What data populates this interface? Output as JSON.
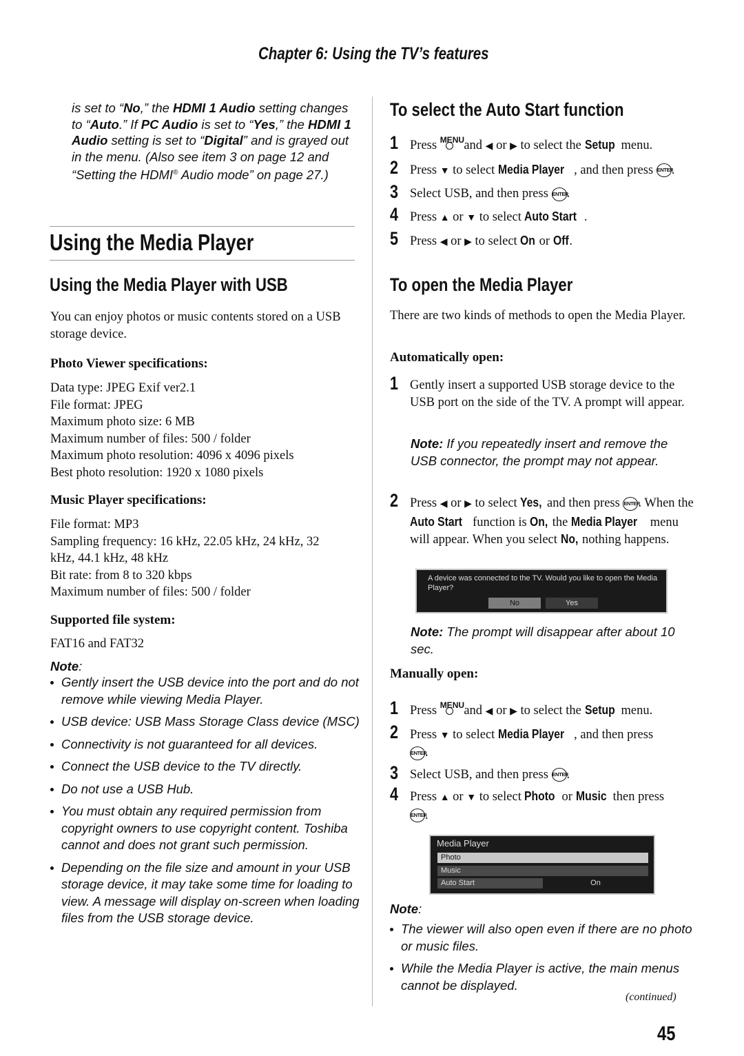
{
  "header": {
    "chapter": "Chapter 6: Using the TV’s features"
  },
  "intro": {
    "parts": [
      {
        "t": "is set to “"
      },
      {
        "t": "No",
        "b": true
      },
      {
        "t": ",” the "
      },
      {
        "t": "HDMI 1 Audio",
        "b": true
      },
      {
        "t": " setting changes to “"
      },
      {
        "t": "Auto",
        "b": true
      },
      {
        "t": ".” If "
      },
      {
        "t": "PC Audio",
        "b": true
      },
      {
        "t": " is set to “"
      },
      {
        "t": "Yes",
        "b": true
      },
      {
        "t": ",” the "
      },
      {
        "t": "HDMI 1 Audio",
        "b": true
      },
      {
        "t": " setting is set to “"
      },
      {
        "t": "Digital",
        "b": true
      },
      {
        "t": "” and is grayed out in the menu. (Also see item 3 on page 12 and “Setting the HDMI"
      },
      {
        "t": "®",
        "sup": true
      },
      {
        "t": " Audio mode” on page 27.)"
      }
    ]
  },
  "left": {
    "title": "Using the Media Player",
    "subtitle": "Using the Media Player with USB",
    "intro_text": "You can enjoy photos or music contents stored on a USB storage device.",
    "photo_heading": "Photo Viewer specifications:",
    "photo_specs": [
      "Data type: JPEG Exif ver2.1",
      "File format: JPEG",
      "Maximum photo size: 6 MB",
      "Maximum number of files: 500 / folder",
      "Maximum photo resolution: 4096 x 4096 pixels",
      "Best photo resolution: 1920 x 1080 pixels"
    ],
    "music_heading": "Music Player specifications:",
    "music_specs": [
      "File format: MP3",
      "Sampling frequency: 16 kHz, 22.05 kHz, 24 kHz, 32 kHz, 44.1 kHz, 48 kHz",
      "Bit rate: from 8 to 320 kbps",
      "Maximum number of files: 500 / folder"
    ],
    "fs_heading": "Supported file system:",
    "fs_text": "FAT16 and FAT32",
    "note_label": "Note",
    "notes": [
      "Gently insert the USB device into the port and do not remove while viewing Media Player.",
      "USB device: USB Mass Storage Class device (MSC)",
      "Connectivity is not guaranteed for all devices.",
      "Connect the USB device to the TV directly.",
      "Do not use a USB Hub.",
      "You must obtain any required permission from copyright owners to use copyright content. Toshiba cannot and does not grant such permission.",
      "Depending on the file size and amount in your USB storage device, it may take some time for loading to view. A message will display on-screen when loading files from the USB storage device."
    ]
  },
  "right": {
    "autostart_title": "To select the Auto Start function",
    "autostart_steps": [
      {
        "n": "1",
        "parts": [
          {
            "t": "Press "
          },
          {
            "icon": "menu"
          },
          {
            "t": " and "
          },
          {
            "tri": "◀"
          },
          {
            "t": " or "
          },
          {
            "tri": "▶"
          },
          {
            "t": " to select the "
          },
          {
            "k": "Setup"
          },
          {
            "t": " menu."
          }
        ]
      },
      {
        "n": "2",
        "parts": [
          {
            "t": "Press "
          },
          {
            "tri": "▼"
          },
          {
            "t": " to select "
          },
          {
            "k": "Media Player"
          },
          {
            "t": ", and then press "
          },
          {
            "icon": "enter"
          },
          {
            "t": "."
          }
        ]
      },
      {
        "n": "3",
        "parts": [
          {
            "t": "Select USB, and then press "
          },
          {
            "icon": "enter"
          },
          {
            "t": "."
          }
        ]
      },
      {
        "n": "4",
        "parts": [
          {
            "t": "Press "
          },
          {
            "tri": "▲"
          },
          {
            "t": " or "
          },
          {
            "tri": "▼"
          },
          {
            "t": " to select "
          },
          {
            "k": "Auto Start"
          },
          {
            "t": "."
          }
        ]
      },
      {
        "n": "5",
        "parts": [
          {
            "t": "Press "
          },
          {
            "tri": "◀"
          },
          {
            "t": " or "
          },
          {
            "tri": "▶"
          },
          {
            "t": " to select "
          },
          {
            "k": "On"
          },
          {
            "t": " or "
          },
          {
            "k": "Off"
          },
          {
            "t": "."
          }
        ]
      }
    ],
    "open_title": "To open the Media Player",
    "open_intro": "There are two kinds of methods to open the Media Player.",
    "auto_heading": "Automatically open:",
    "auto_step1": {
      "n": "1",
      "parts": [
        {
          "t": "Gently insert a supported USB storage device to the USB port on the side of the TV. A prompt will appear."
        }
      ]
    },
    "auto_note1_label": "Note:",
    "auto_note1": " If you repeatedly insert and remove the USB connector, the prompt may not appear.",
    "auto_step2": {
      "n": "2",
      "parts": [
        {
          "t": "Press "
        },
        {
          "tri": "◀"
        },
        {
          "t": " or "
        },
        {
          "tri": "▶"
        },
        {
          "t": " to select "
        },
        {
          "k": "Yes,"
        },
        {
          "t": " and then press "
        },
        {
          "icon": "enter"
        },
        {
          "t": ". When the "
        },
        {
          "k": "Auto Start"
        },
        {
          "t": " function is "
        },
        {
          "k": "On,"
        },
        {
          "t": " the "
        },
        {
          "k": "Media Player"
        },
        {
          "t": " menu will appear. When you select "
        },
        {
          "k": "No,"
        },
        {
          "t": " nothing happens."
        }
      ]
    },
    "prompt_osd": {
      "message": "A device was connected to the TV. Would you like to open the Media Player?",
      "no_label": "No",
      "yes_label": "Yes"
    },
    "auto_note2_label": "Note:",
    "auto_note2": " The prompt will disappear after about 10 sec.",
    "manual_heading": "Manually open:",
    "manual_steps": [
      {
        "n": "1",
        "parts": [
          {
            "t": "Press "
          },
          {
            "icon": "menu"
          },
          {
            "t": " and "
          },
          {
            "tri": "◀"
          },
          {
            "t": " or "
          },
          {
            "tri": "▶"
          },
          {
            "t": " to select the "
          },
          {
            "k": "Setup"
          },
          {
            "t": " menu."
          }
        ]
      },
      {
        "n": "2",
        "parts": [
          {
            "t": "Press "
          },
          {
            "tri": "▼"
          },
          {
            "t": " to select "
          },
          {
            "k": "Media Player"
          },
          {
            "t": ", and then press "
          },
          {
            "br": true
          },
          {
            "icon": "enter"
          },
          {
            "t": "."
          }
        ]
      },
      {
        "n": "3",
        "parts": [
          {
            "t": "Select USB, and then press "
          },
          {
            "icon": "enter"
          },
          {
            "t": "."
          }
        ]
      },
      {
        "n": "4",
        "parts": [
          {
            "t": "Press "
          },
          {
            "tri": "▲"
          },
          {
            "t": " or "
          },
          {
            "tri": "▼"
          },
          {
            "t": " to select "
          },
          {
            "k": "Photo"
          },
          {
            "t": " or "
          },
          {
            "k": "Music"
          },
          {
            "t": " then press "
          },
          {
            "br": true
          },
          {
            "icon": "enter"
          },
          {
            "t": "."
          }
        ]
      }
    ],
    "menu_osd": {
      "title": "Media Player",
      "items": [
        "Photo",
        "Music"
      ],
      "autostart_label": "Auto Start",
      "autostart_value": "On"
    },
    "note_label": "Note",
    "notes": [
      "The viewer will also open even if there are no photo or music files.",
      "While the Media Player is active, the main menus cannot be displayed."
    ],
    "continued": "(continued)"
  },
  "footer": {
    "page_number": "45"
  },
  "icons": {
    "menu_label": "MENU",
    "enter_label": "ENTER"
  }
}
